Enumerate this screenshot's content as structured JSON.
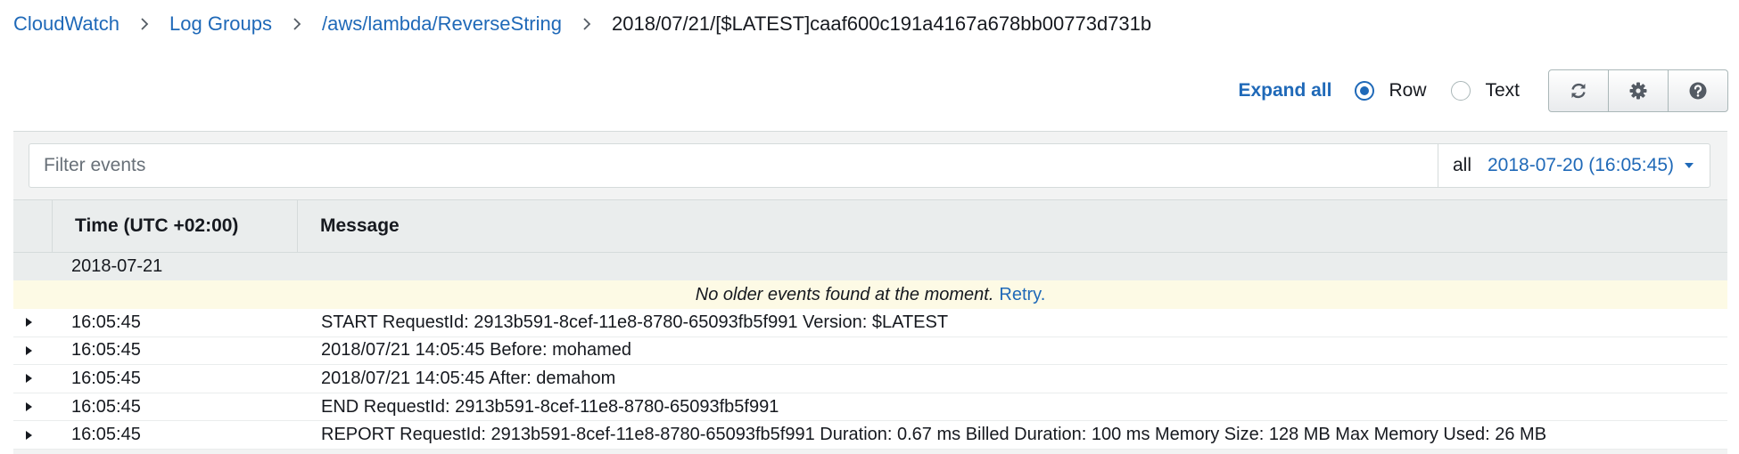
{
  "breadcrumb": {
    "items": [
      "CloudWatch",
      "Log Groups",
      "/aws/lambda/ReverseString"
    ],
    "current": "2018/07/21/[$LATEST]caaf600c191a4167a678bb00773d731b"
  },
  "toolbar": {
    "expand_all": "Expand all",
    "view_options": [
      {
        "label": "Row",
        "selected": true
      },
      {
        "label": "Text",
        "selected": false
      }
    ],
    "buttons": [
      "refresh-icon",
      "gear-icon",
      "help-icon"
    ]
  },
  "filter": {
    "placeholder": "Filter events",
    "value": "",
    "scope": "all",
    "date": "2018-07-20 (16:05:45)"
  },
  "table": {
    "columns": [
      "Time (UTC +02:00)",
      "Message"
    ],
    "date_group": "2018-07-21",
    "notice": "No older events found at the moment.",
    "retry": "Retry.",
    "rows": [
      {
        "time": "16:05:45",
        "message": "START RequestId: 2913b591-8cef-11e8-8780-65093fb5f991 Version: $LATEST"
      },
      {
        "time": "16:05:45",
        "message": "2018/07/21 14:05:45 Before: mohamed"
      },
      {
        "time": "16:05:45",
        "message": "2018/07/21 14:05:45 After: demahom"
      },
      {
        "time": "16:05:45",
        "message": "END RequestId: 2913b591-8cef-11e8-8780-65093fb5f991"
      },
      {
        "time": "16:05:45",
        "message": "REPORT RequestId: 2913b591-8cef-11e8-8780-65093fb5f991 Duration: 0.67 ms Billed Duration: 100 ms Memory Size: 128 MB Max Memory Used: 26 MB"
      }
    ]
  },
  "colors": {
    "link": "#1f69b8",
    "notice_bg": "#fdfae5",
    "header_bg": "#eaeded"
  }
}
